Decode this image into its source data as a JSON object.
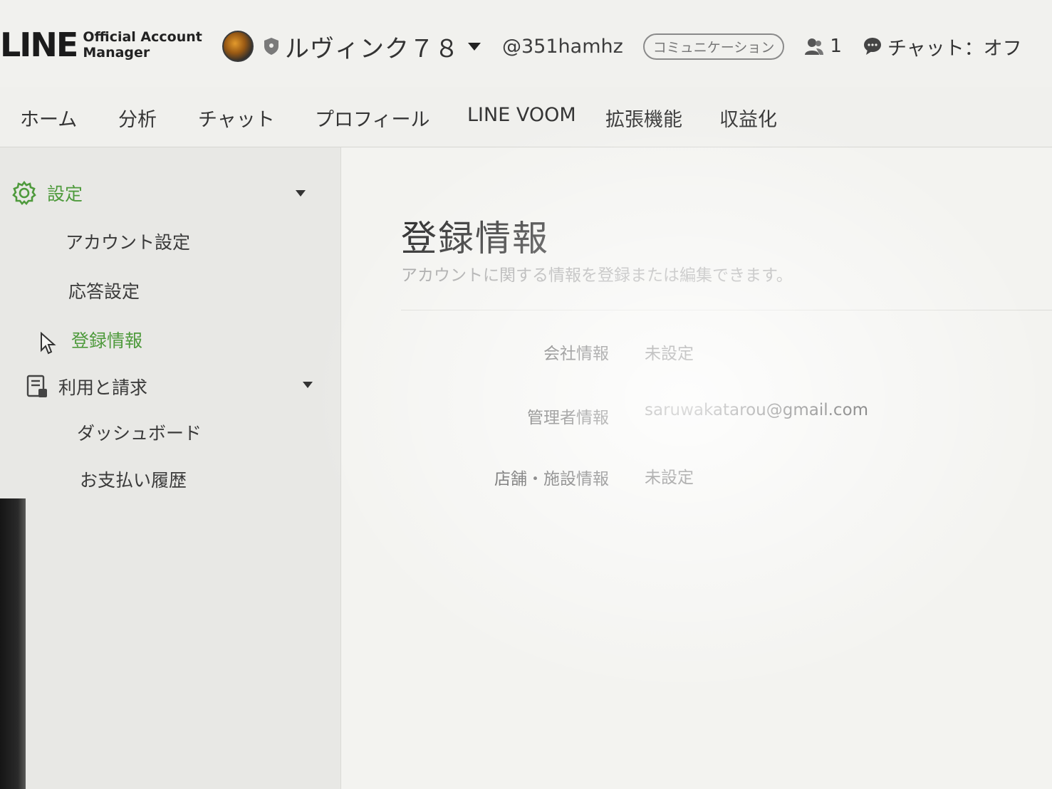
{
  "header": {
    "logo_main": "LINE",
    "logo_sub_line1": "Official Account",
    "logo_sub_line2": "Manager",
    "account_name": "ルヴィンク７８",
    "account_id": "@351hamhz",
    "plan_badge": "コミュニケーション",
    "friend_count": "1",
    "chat_status": "チャット：オフ"
  },
  "nav": {
    "tabs": [
      "ホーム",
      "分析",
      "チャット",
      "プロフィール",
      "LINE VOOM",
      "拡張機能",
      "収益化"
    ]
  },
  "sidebar": {
    "settings_label": "設定",
    "settings_items": [
      "アカウント設定",
      "応答設定",
      "登録情報"
    ],
    "active_item": "登録情報",
    "billing_label": "利用と請求",
    "billing_items": [
      "ダッシュボード",
      "お支払い履歴"
    ]
  },
  "main": {
    "title": "登録情報",
    "description": "アカウントに関する情報を登録または編集できます。",
    "rows": [
      {
        "label": "会社情報",
        "value": "未設定"
      },
      {
        "label": "管理者情報",
        "value": "saruwakatarou@gmail.com"
      },
      {
        "label": "店舗・施設情報",
        "value": "未設定"
      }
    ]
  },
  "colors": {
    "accent_green": "#4e9a3c",
    "text_dark": "#2c2c2c",
    "text_muted": "#a3a3a3"
  },
  "icons": {
    "settings": "gear-icon",
    "billing": "receipt-icon",
    "friends": "person-icon",
    "chat": "chat-bubble-icon",
    "verified": "shield-icon"
  }
}
